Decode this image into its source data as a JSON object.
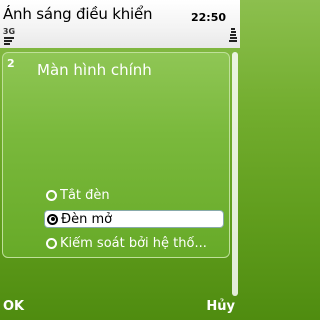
{
  "status": {
    "title": "Ánh sáng điều khiển",
    "time": "22:50",
    "network": "3G",
    "icons": [
      "signal-strength-icon",
      "battery-icon"
    ]
  },
  "list": {
    "item_index": "2",
    "item_label": "Màn hình chính"
  },
  "options": [
    {
      "label": "Tắt đèn",
      "selected": false
    },
    {
      "label": "Đèn mở",
      "selected": true
    },
    {
      "label": "Kiểm soát bởi hệ thố...",
      "selected": false
    }
  ],
  "softkeys": {
    "left": "OK",
    "right": "Hủy"
  },
  "colors": {
    "background": "#6aa82a",
    "status_bar": "#f3f3f3",
    "highlight": "#ffffff"
  }
}
